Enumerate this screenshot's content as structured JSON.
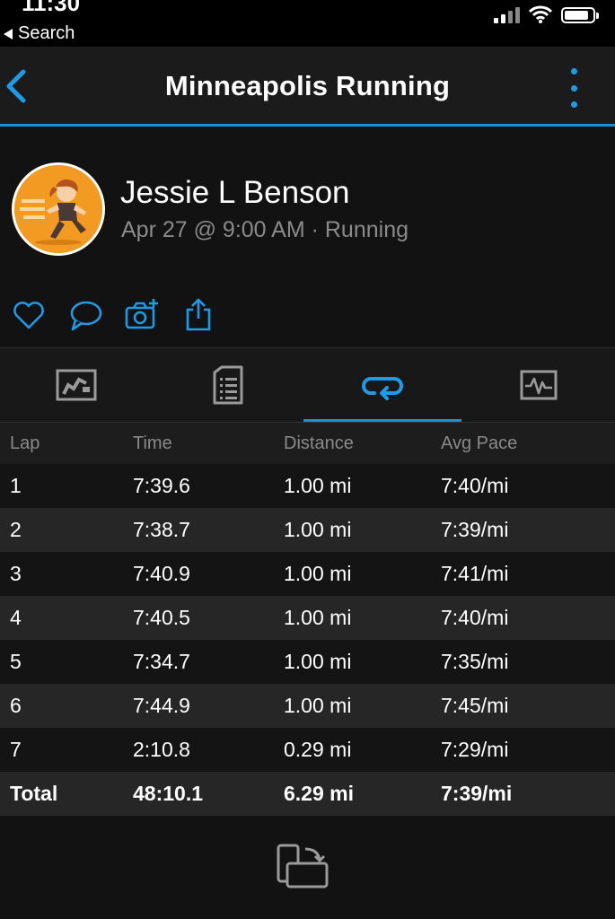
{
  "status_bar": {
    "time": "11:30",
    "back_label": "Search"
  },
  "nav": {
    "title": "Minneapolis Running"
  },
  "profile": {
    "name": "Jessie L Benson",
    "subtitle": "Apr 27 @ 9:00 AM · Running"
  },
  "colors": {
    "accent": "#1e9be6",
    "avatar": "#f39a22",
    "background": "#121212"
  },
  "actions": [
    {
      "icon": "heart-icon"
    },
    {
      "icon": "comment-icon"
    },
    {
      "icon": "add-photo-icon"
    },
    {
      "icon": "share-icon"
    }
  ],
  "tabs": [
    {
      "icon": "map-icon",
      "active": false
    },
    {
      "icon": "stats-icon",
      "active": false
    },
    {
      "icon": "laps-icon",
      "active": true
    },
    {
      "icon": "charts-icon",
      "active": false
    }
  ],
  "laps": {
    "headers": [
      "Lap",
      "Time",
      "Distance",
      "Avg Pace"
    ],
    "rows": [
      [
        "1",
        "7:39.6",
        "1.00 mi",
        "7:40/mi"
      ],
      [
        "2",
        "7:38.7",
        "1.00 mi",
        "7:39/mi"
      ],
      [
        "3",
        "7:40.9",
        "1.00 mi",
        "7:41/mi"
      ],
      [
        "4",
        "7:40.5",
        "1.00 mi",
        "7:40/mi"
      ],
      [
        "5",
        "7:34.7",
        "1.00 mi",
        "7:35/mi"
      ],
      [
        "6",
        "7:44.9",
        "1.00 mi",
        "7:45/mi"
      ],
      [
        "7",
        "2:10.8",
        "0.29 mi",
        "7:29/mi"
      ]
    ],
    "total": [
      "Total",
      "48:10.1",
      "6.29 mi",
      "7:39/mi"
    ]
  }
}
